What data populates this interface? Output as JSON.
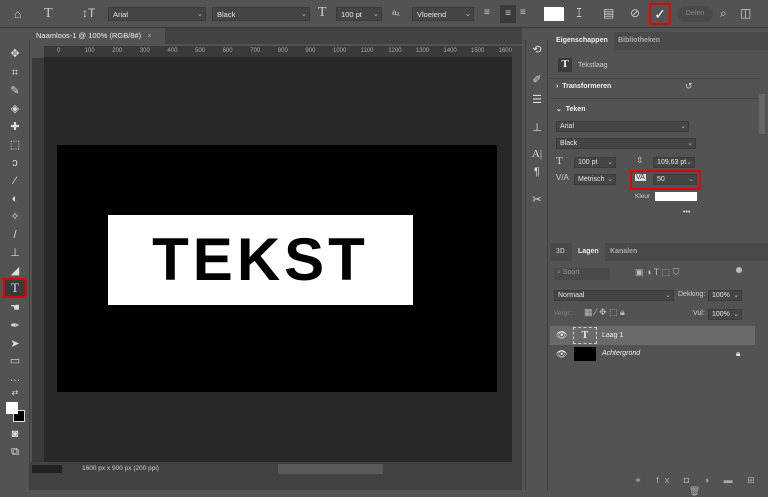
{
  "options_bar": {
    "font_family": "Arial",
    "font_style": "Black",
    "font_size": "100 pt",
    "antialias_icon": "aa-icon",
    "antialias": "Vloeiend",
    "text_color": "#ffffff",
    "share_label": "Delen"
  },
  "document": {
    "tab_title": "Naamloos-1 @ 100% (RGB/8#)",
    "text": "TEKST",
    "status": "1600 px x 900 px (200 ppi)",
    "ruler_top": [
      "0",
      "100",
      "200",
      "300",
      "400",
      "500",
      "600",
      "700",
      "800",
      "900",
      "1000",
      "1100",
      "1200",
      "1300",
      "1400",
      "1500",
      "1600"
    ]
  },
  "properties": {
    "tabs": [
      "Eigenschappen",
      "Bibliotheken"
    ],
    "layer_type": "Tekstlaag",
    "transform_label": "Transformeren",
    "character_label": "Teken",
    "font_family": "Arial",
    "font_style": "Black",
    "font_size": "100 pt",
    "leading": "109,63 pt",
    "kerning": "Metrisch",
    "tracking": "50",
    "color_label": "Kleur",
    "color": "#ffffff",
    "more": "•••"
  },
  "layers": {
    "tabs": [
      "3D",
      "Lagen",
      "Kanalen"
    ],
    "search_placeholder": "Soort",
    "blend_mode": "Normaal",
    "opacity_label": "Dekking:",
    "opacity": "100%",
    "lock_label": "Vergr.:",
    "fill_label": "Vul:",
    "fill": "100%",
    "items": [
      {
        "name": "Laag 1",
        "type": "text",
        "selected": true
      },
      {
        "name": "Achtergrond",
        "type": "background",
        "locked": true
      }
    ]
  },
  "highlight_color": "#e00000"
}
